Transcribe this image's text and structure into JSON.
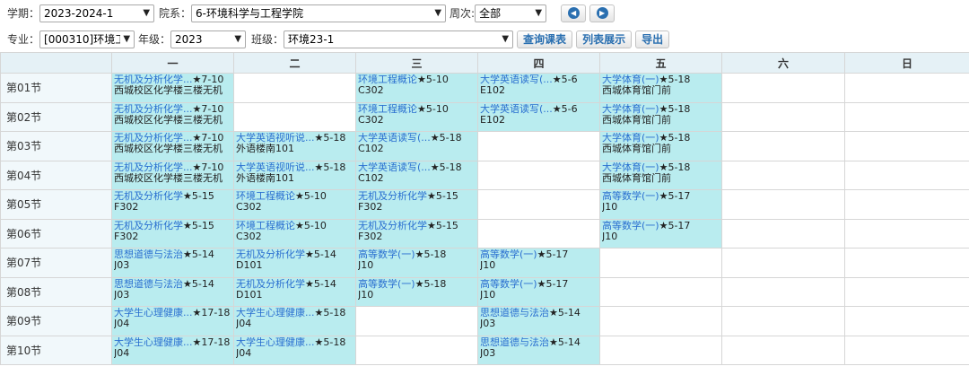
{
  "filters": {
    "term_label": "学期：",
    "term_value": "2023-2024-1",
    "dept_label": "院系：",
    "dept_value": "6-环境科学与工程学院",
    "week_label": "周次:",
    "week_value": "全部",
    "major_label": "专业：",
    "major_value": "[000310]环境工程",
    "grade_label": "年级：",
    "grade_value": "2023",
    "class_label": "班级：",
    "class_value": "环境23-1",
    "query_button": "查询课表",
    "list_button": "列表展示",
    "export_button": "导出"
  },
  "schedule": {
    "days": [
      "一",
      "二",
      "三",
      "四",
      "五",
      "六",
      "日"
    ],
    "rows": [
      {
        "period": "第01节",
        "cells": [
          {
            "name": "无机及分析化学...",
            "weeks": "★7-10",
            "room": "西城校区化学楼三楼无机"
          },
          null,
          {
            "name": "环境工程概论",
            "weeks": "★5-10",
            "room": "C302"
          },
          {
            "name": "大学英语读写(...",
            "weeks": "★5-6",
            "room": "E102"
          },
          {
            "name": "大学体育(一)",
            "weeks": "★5-18",
            "room": "西城体育馆门前"
          },
          null,
          null
        ]
      },
      {
        "period": "第02节",
        "cells": [
          {
            "name": "无机及分析化学...",
            "weeks": "★7-10",
            "room": "西城校区化学楼三楼无机"
          },
          null,
          {
            "name": "环境工程概论",
            "weeks": "★5-10",
            "room": "C302"
          },
          {
            "name": "大学英语读写(...",
            "weeks": "★5-6",
            "room": "E102"
          },
          {
            "name": "大学体育(一)",
            "weeks": "★5-18",
            "room": "西城体育馆门前"
          },
          null,
          null
        ]
      },
      {
        "period": "第03节",
        "cells": [
          {
            "name": "无机及分析化学...",
            "weeks": "★7-10",
            "room": "西城校区化学楼三楼无机"
          },
          {
            "name": "大学英语视听说...",
            "weeks": "★5-18",
            "room": "外语楼南101"
          },
          {
            "name": "大学英语读写(...",
            "weeks": "★5-18",
            "room": "C102"
          },
          null,
          {
            "name": "大学体育(一)",
            "weeks": "★5-18",
            "room": "西城体育馆门前"
          },
          null,
          null
        ]
      },
      {
        "period": "第04节",
        "cells": [
          {
            "name": "无机及分析化学...",
            "weeks": "★7-10",
            "room": "西城校区化学楼三楼无机"
          },
          {
            "name": "大学英语视听说...",
            "weeks": "★5-18",
            "room": "外语楼南101"
          },
          {
            "name": "大学英语读写(...",
            "weeks": "★5-18",
            "room": "C102"
          },
          null,
          {
            "name": "大学体育(一)",
            "weeks": "★5-18",
            "room": "西城体育馆门前"
          },
          null,
          null
        ]
      },
      {
        "period": "第05节",
        "cells": [
          {
            "name": "无机及分析化学",
            "weeks": "★5-15",
            "room": "F302"
          },
          {
            "name": "环境工程概论",
            "weeks": "★5-10",
            "room": "C302"
          },
          {
            "name": "无机及分析化学",
            "weeks": "★5-15",
            "room": "F302"
          },
          null,
          {
            "name": "高等数学(一)",
            "weeks": "★5-17",
            "room": "J10"
          },
          null,
          null
        ]
      },
      {
        "period": "第06节",
        "cells": [
          {
            "name": "无机及分析化学",
            "weeks": "★5-15",
            "room": "F302"
          },
          {
            "name": "环境工程概论",
            "weeks": "★5-10",
            "room": "C302"
          },
          {
            "name": "无机及分析化学",
            "weeks": "★5-15",
            "room": "F302"
          },
          null,
          {
            "name": "高等数学(一)",
            "weeks": "★5-17",
            "room": "J10"
          },
          null,
          null
        ]
      },
      {
        "period": "第07节",
        "cells": [
          {
            "name": "思想道德与法治",
            "weeks": "★5-14",
            "room": "J03"
          },
          {
            "name": "无机及分析化学",
            "weeks": "★5-14",
            "room": "D101"
          },
          {
            "name": "高等数学(一)",
            "weeks": "★5-18",
            "room": "J10"
          },
          {
            "name": "高等数学(一)",
            "weeks": "★5-17",
            "room": "J10"
          },
          null,
          null,
          null
        ]
      },
      {
        "period": "第08节",
        "cells": [
          {
            "name": "思想道德与法治",
            "weeks": "★5-14",
            "room": "J03"
          },
          {
            "name": "无机及分析化学",
            "weeks": "★5-14",
            "room": "D101"
          },
          {
            "name": "高等数学(一)",
            "weeks": "★5-18",
            "room": "J10"
          },
          {
            "name": "高等数学(一)",
            "weeks": "★5-17",
            "room": "J10"
          },
          null,
          null,
          null
        ]
      },
      {
        "period": "第09节",
        "cells": [
          {
            "name": "大学生心理健康...",
            "weeks": "★17-18",
            "room": "J04"
          },
          {
            "name": "大学生心理健康...",
            "weeks": "★5-18",
            "room": "J04"
          },
          null,
          {
            "name": "思想道德与法治",
            "weeks": "★5-14",
            "room": "J03"
          },
          null,
          null,
          null
        ]
      },
      {
        "period": "第10节",
        "cells": [
          {
            "name": "大学生心理健康...",
            "weeks": "★17-18",
            "room": "J04"
          },
          {
            "name": "大学生心理健康...",
            "weeks": "★5-18",
            "room": "J04"
          },
          null,
          {
            "name": "思想道德与法治",
            "weeks": "★5-14",
            "room": "J03"
          },
          null,
          null,
          null
        ]
      }
    ]
  },
  "colors": {
    "course_cell_bg": "#b9ecef",
    "course_name": "#2a6fd0",
    "header_bg": "#e5f1f6",
    "button_text": "#2a6fb0"
  }
}
